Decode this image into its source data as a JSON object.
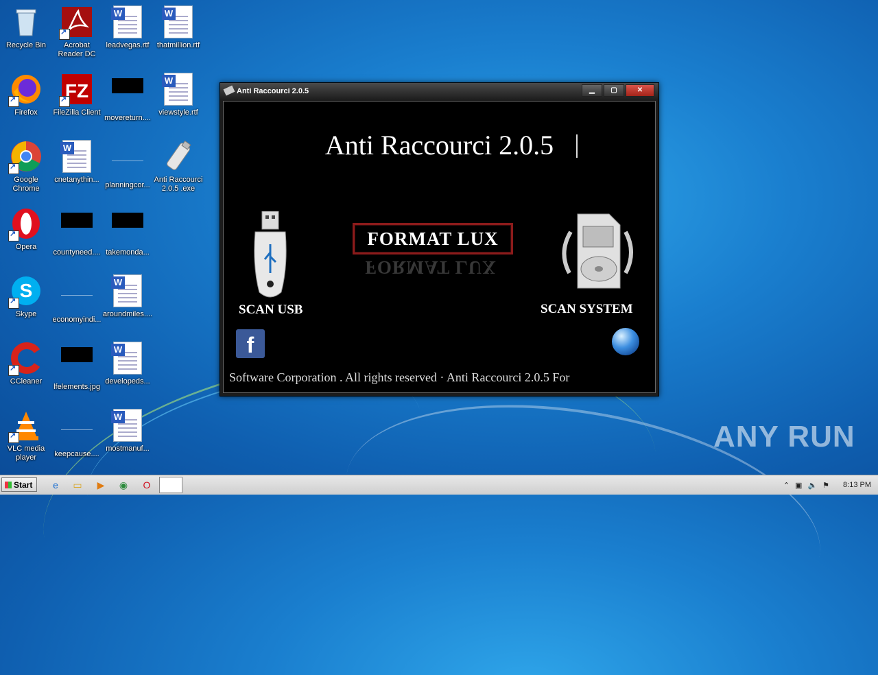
{
  "desktop": {
    "icons": [
      {
        "label": "Recycle Bin",
        "icon": "recycle-bin-icon"
      },
      {
        "label": "Acrobat Reader DC",
        "icon": "acrobat-icon"
      },
      {
        "label": "leadvegas.rtf",
        "icon": "word-doc-icon"
      },
      {
        "label": "thatmillion.rtf",
        "icon": "word-doc-icon"
      },
      {
        "label": "Firefox",
        "icon": "firefox-icon"
      },
      {
        "label": "FileZilla Client",
        "icon": "filezilla-icon"
      },
      {
        "label": "movereturn....",
        "icon": "black-image-icon"
      },
      {
        "label": "viewstyle.rtf",
        "icon": "word-doc-icon"
      },
      {
        "label": "Google Chrome",
        "icon": "chrome-icon"
      },
      {
        "label": "cnetanythin...",
        "icon": "word-doc-icon"
      },
      {
        "label": "planningcor...",
        "icon": "blue-image-icon"
      },
      {
        "label": "Anti Raccourci 2.0.5 .exe",
        "icon": "usb-drive-icon"
      },
      {
        "label": "Opera",
        "icon": "opera-icon"
      },
      {
        "label": "countyneed....",
        "icon": "black-image-icon"
      },
      {
        "label": "takemonda...",
        "icon": "black-image-icon"
      },
      {
        "label": "Skype",
        "icon": "skype-icon"
      },
      {
        "label": "economyindi...",
        "icon": "blue-image-icon"
      },
      {
        "label": "aroundmiles....",
        "icon": "word-doc-icon"
      },
      {
        "label": "CCleaner",
        "icon": "ccleaner-icon"
      },
      {
        "label": "lfelements.jpg",
        "icon": "black-image-icon"
      },
      {
        "label": "developeds...",
        "icon": "word-doc-icon"
      },
      {
        "label": "VLC media player",
        "icon": "vlc-icon"
      },
      {
        "label": "keepcause....",
        "icon": "blue-image-icon"
      },
      {
        "label": "mostmanuf...",
        "icon": "word-doc-icon"
      }
    ]
  },
  "window": {
    "title": "Anti Raccourci 2.0.5",
    "app_title": "Anti Raccourci 2.0.5",
    "format_button": "FORMAT LUX",
    "scan_usb": "SCAN USB",
    "scan_system": "SCAN SYSTEM",
    "marquee": "Software Corporation . All rights reserved  ·  Anti Raccourci 2.0.5  For",
    "facebook_glyph": "f"
  },
  "taskbar": {
    "start_label": "Start",
    "clock": "8:13 PM"
  },
  "watermark": "ANY RUN",
  "colors": {
    "accent_red": "#8c1b1b",
    "facebook_blue": "#3b5998",
    "desktop_blue": "#1a7fcf"
  }
}
